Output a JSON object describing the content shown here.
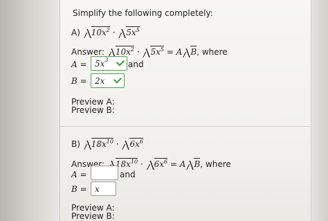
{
  "instruction": "Simplify the following completely:",
  "part_a": {
    "label": "A)",
    "expr_rad1": "10x",
    "expr_rad1_exp": "2",
    "expr_rad2": "5x",
    "expr_rad2_exp": "5",
    "answer_prefix": "Answer:",
    "answer_equals": "= A",
    "answer_B": "B",
    "where": ", where",
    "A_label": "A =",
    "A_value": "5x",
    "A_value_exp": "3",
    "and": "and",
    "B_label": "B =",
    "B_value": "2x",
    "preview_A": "Preview A:",
    "preview_B": "Preview B:"
  },
  "part_b": {
    "label": "B)",
    "expr_rad1": "18x",
    "expr_rad1_exp": "10",
    "expr_rad2": "6x",
    "expr_rad2_exp": "6",
    "answer_prefix": "Answer:",
    "answer_equals": "= A",
    "answer_B": "B",
    "where": ", where",
    "A_label": "A =",
    "A_value": "",
    "and": "and",
    "B_label": "B =",
    "B_value": "x",
    "preview_A": "Preview A:",
    "preview_B": "Preview B:"
  },
  "colors": {
    "correct_border": "#4aa64a",
    "checkmark": "#3a9a3a"
  },
  "icons": {
    "correct": "checkmark-icon"
  }
}
